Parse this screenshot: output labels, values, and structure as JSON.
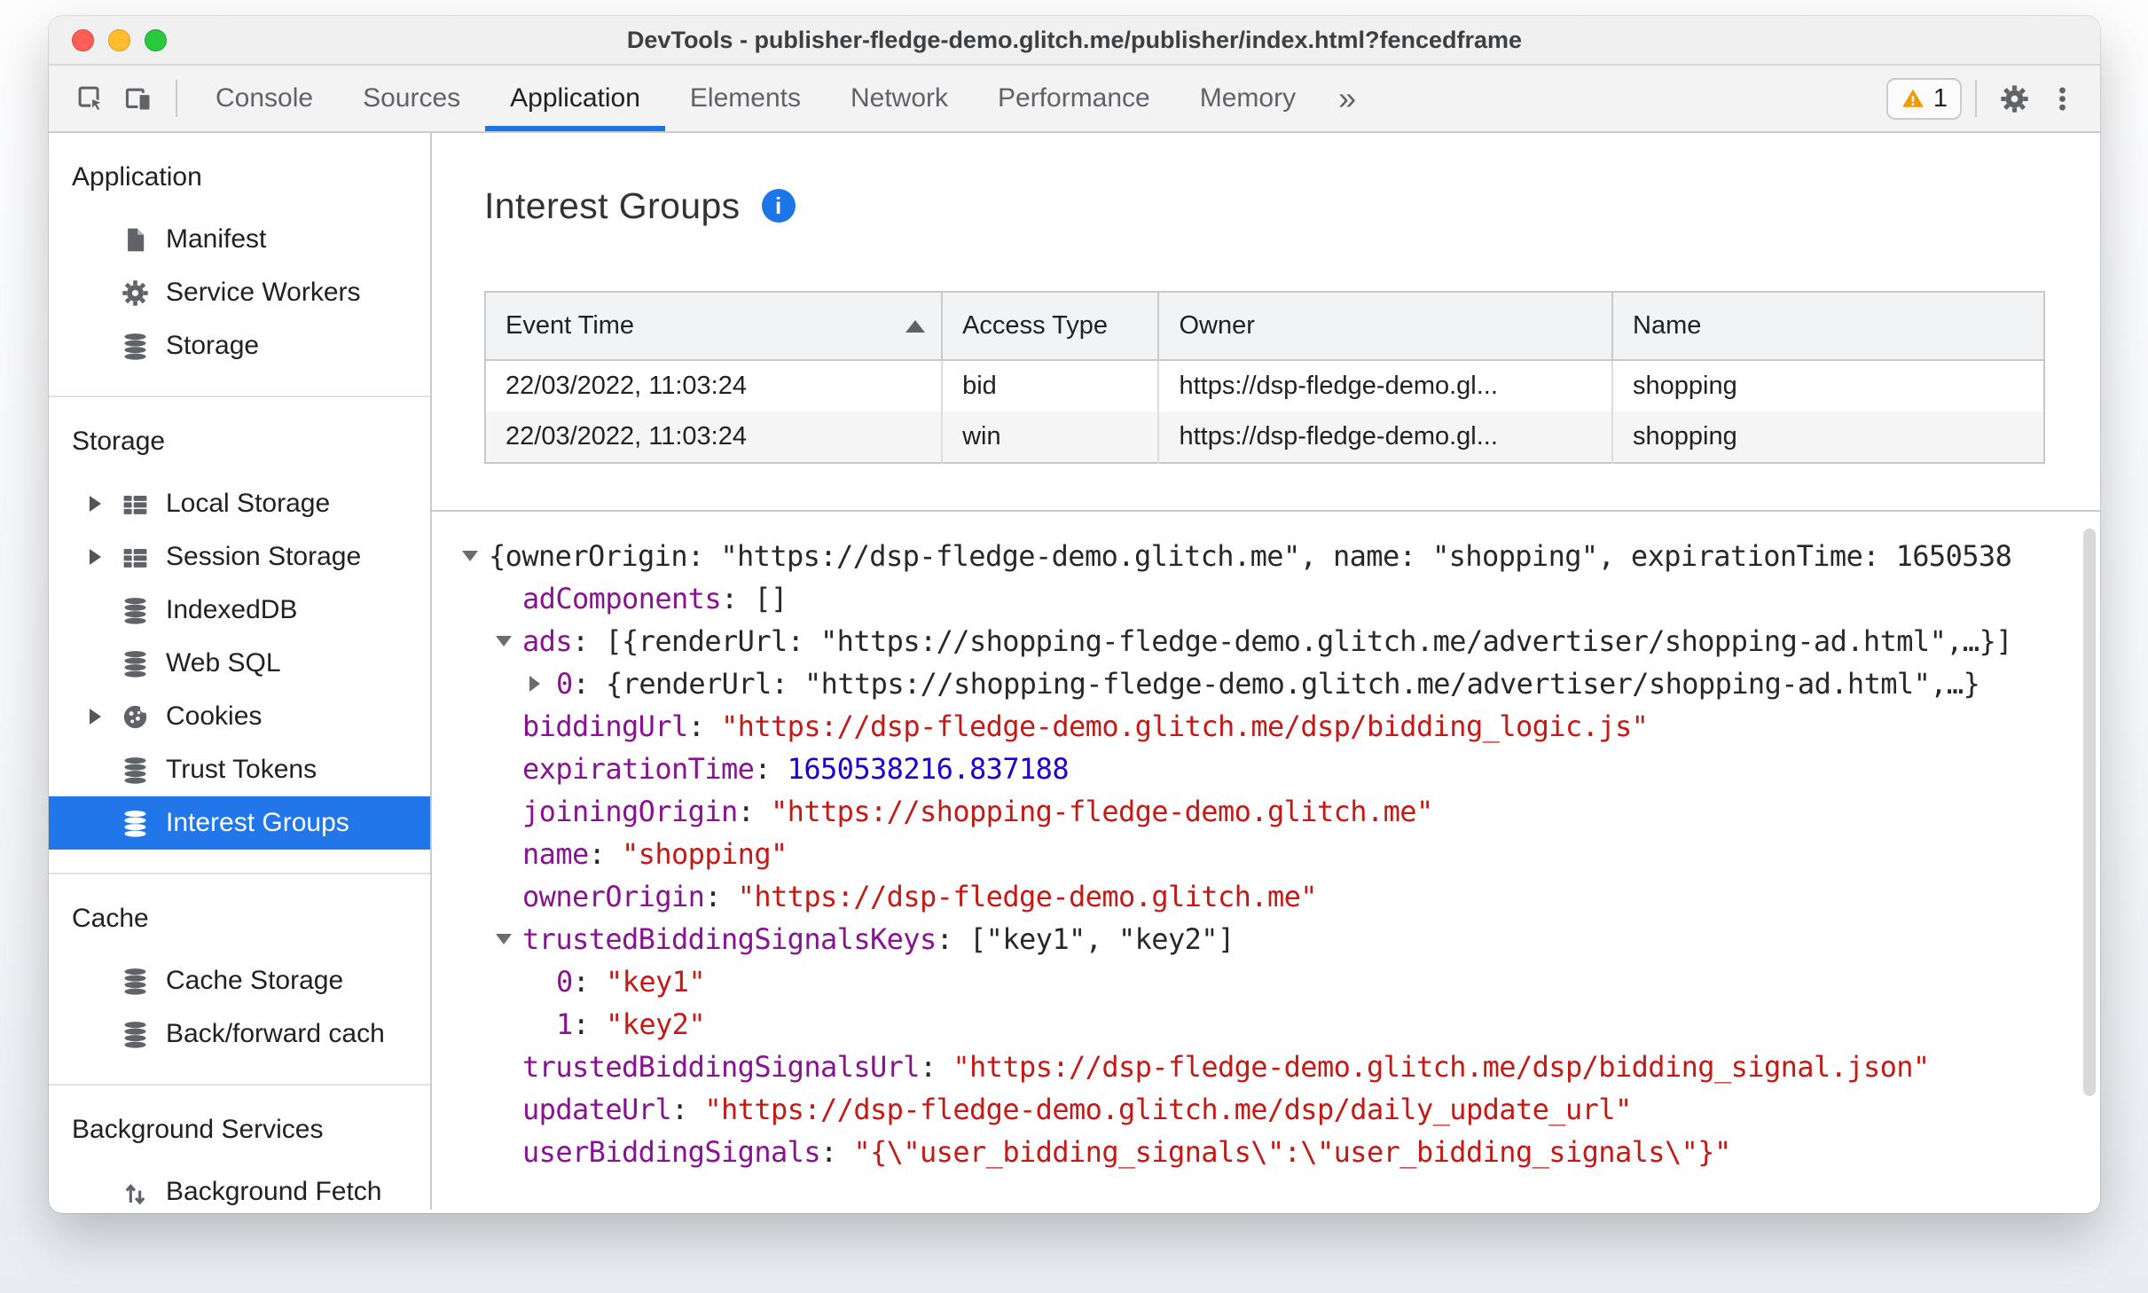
{
  "window": {
    "title": "DevTools - publisher-fledge-demo.glitch.me/publisher/index.html?fencedframe"
  },
  "toolbar": {
    "tabs": [
      {
        "label": "Console"
      },
      {
        "label": "Sources"
      },
      {
        "label": "Application",
        "selected": true
      },
      {
        "label": "Elements"
      },
      {
        "label": "Network"
      },
      {
        "label": "Performance"
      },
      {
        "label": "Memory"
      },
      {
        "label": "»",
        "more": true
      }
    ],
    "warning_count": "1"
  },
  "sidebar": {
    "sections": [
      {
        "title": "Application",
        "items": [
          {
            "label": "Manifest",
            "icon": "file"
          },
          {
            "label": "Service Workers",
            "icon": "gear"
          },
          {
            "label": "Storage",
            "icon": "database"
          }
        ]
      },
      {
        "title": "Storage",
        "items": [
          {
            "label": "Local Storage",
            "icon": "grid",
            "expandable": true
          },
          {
            "label": "Session Storage",
            "icon": "grid",
            "expandable": true
          },
          {
            "label": "IndexedDB",
            "icon": "database"
          },
          {
            "label": "Web SQL",
            "icon": "database"
          },
          {
            "label": "Cookies",
            "icon": "cookie",
            "expandable": true
          },
          {
            "label": "Trust Tokens",
            "icon": "database"
          },
          {
            "label": "Interest Groups",
            "icon": "database",
            "selected": true
          }
        ]
      },
      {
        "title": "Cache",
        "items": [
          {
            "label": "Cache Storage",
            "icon": "database"
          },
          {
            "label": "Back/forward cach",
            "icon": "database"
          }
        ]
      },
      {
        "title": "Background Services",
        "items": [
          {
            "label": "Background Fetch",
            "icon": "fetch"
          }
        ]
      }
    ]
  },
  "main": {
    "title": "Interest Groups",
    "info_icon": "i",
    "table": {
      "columns": [
        "Event Time",
        "Access Type",
        "Owner",
        "Name"
      ],
      "sort": {
        "column": "Event Time",
        "direction": "asc"
      },
      "rows": [
        [
          "22/03/2022, 11:03:24",
          "bid",
          "https://dsp-fledge-demo.gl...",
          "shopping"
        ],
        [
          "22/03/2022, 11:03:24",
          "win",
          "https://dsp-fledge-demo.gl...",
          "shopping"
        ]
      ]
    },
    "tree": {
      "lines": [
        {
          "a": "d",
          "l": 0,
          "seg": [
            [
              "p",
              "{ownerOrigin: \"https://dsp-fledge-demo.glitch.me\", name: \"shopping\", expirationTime: 1650538"
            ]
          ]
        },
        {
          "a": "",
          "l": 1,
          "seg": [
            [
              "k",
              "adComponents"
            ],
            [
              "p",
              ": []"
            ]
          ]
        },
        {
          "a": "d",
          "l": 1,
          "seg": [
            [
              "k",
              "ads"
            ],
            [
              "p",
              ": [{renderUrl: \"https://shopping-fledge-demo.glitch.me/advertiser/shopping-ad.html\",…}]"
            ]
          ]
        },
        {
          "a": "r",
          "l": 2,
          "seg": [
            [
              "k",
              "0"
            ],
            [
              "p",
              ": {renderUrl: \"https://shopping-fledge-demo.glitch.me/advertiser/shopping-ad.html\",…}"
            ]
          ]
        },
        {
          "a": "",
          "l": 1,
          "seg": [
            [
              "k",
              "biddingUrl"
            ],
            [
              "p",
              ": "
            ],
            [
              "s",
              "\"https://dsp-fledge-demo.glitch.me/dsp/bidding_logic.js\""
            ]
          ]
        },
        {
          "a": "",
          "l": 1,
          "seg": [
            [
              "k",
              "expirationTime"
            ],
            [
              "p",
              ": "
            ],
            [
              "n",
              "1650538216.837188"
            ]
          ]
        },
        {
          "a": "",
          "l": 1,
          "seg": [
            [
              "k",
              "joiningOrigin"
            ],
            [
              "p",
              ": "
            ],
            [
              "s",
              "\"https://shopping-fledge-demo.glitch.me\""
            ]
          ]
        },
        {
          "a": "",
          "l": 1,
          "seg": [
            [
              "k",
              "name"
            ],
            [
              "p",
              ": "
            ],
            [
              "s",
              "\"shopping\""
            ]
          ]
        },
        {
          "a": "",
          "l": 1,
          "seg": [
            [
              "k",
              "ownerOrigin"
            ],
            [
              "p",
              ": "
            ],
            [
              "s",
              "\"https://dsp-fledge-demo.glitch.me\""
            ]
          ]
        },
        {
          "a": "d",
          "l": 1,
          "seg": [
            [
              "k",
              "trustedBiddingSignalsKeys"
            ],
            [
              "p",
              ": [\"key1\", \"key2\"]"
            ]
          ]
        },
        {
          "a": "",
          "l": 2,
          "seg": [
            [
              "k",
              "0"
            ],
            [
              "p",
              ": "
            ],
            [
              "s",
              "\"key1\""
            ]
          ]
        },
        {
          "a": "",
          "l": 2,
          "seg": [
            [
              "k",
              "1"
            ],
            [
              "p",
              ": "
            ],
            [
              "s",
              "\"key2\""
            ]
          ]
        },
        {
          "a": "",
          "l": 1,
          "seg": [
            [
              "k",
              "trustedBiddingSignalsUrl"
            ],
            [
              "p",
              ": "
            ],
            [
              "s",
              "\"https://dsp-fledge-demo.glitch.me/dsp/bidding_signal.json\""
            ]
          ]
        },
        {
          "a": "",
          "l": 1,
          "seg": [
            [
              "k",
              "updateUrl"
            ],
            [
              "p",
              ": "
            ],
            [
              "s",
              "\"https://dsp-fledge-demo.glitch.me/dsp/daily_update_url\""
            ]
          ]
        },
        {
          "a": "",
          "l": 1,
          "seg": [
            [
              "k",
              "userBiddingSignals"
            ],
            [
              "p",
              ": "
            ],
            [
              "s",
              "\"{\\\"user_bidding_signals\\\":\\\"user_bidding_signals\\\"}\""
            ]
          ]
        }
      ]
    }
  },
  "colors": {
    "accent_blue": "#1a73e8",
    "selection_blue": "#2176e9",
    "warning_amber": "#f29900",
    "json_key": "#881391",
    "json_string": "#c41a16",
    "json_number": "#1c00cf"
  }
}
